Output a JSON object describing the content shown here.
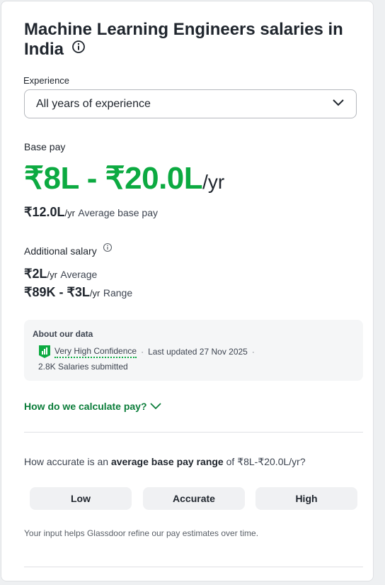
{
  "title": "Machine Learning Engineers salaries in India",
  "experience": {
    "label": "Experience",
    "selected": "All years of experience"
  },
  "base_pay": {
    "label": "Base pay",
    "range": "₹8L - ₹20.0L",
    "unit": "/yr",
    "average_value": "₹12.0L",
    "average_unit": "/yr",
    "average_label": "Average base pay"
  },
  "additional_salary": {
    "label": "Additional salary",
    "average_value": "₹2L",
    "average_unit": "/yr",
    "average_label": "Average",
    "range_value": "₹89K - ₹3L",
    "range_unit": "/yr",
    "range_label": "Range"
  },
  "about_data": {
    "title": "About our data",
    "confidence": "Very High Confidence",
    "separator": "·",
    "updated": "Last updated 27 Nov 2025",
    "submitted": "2.8K Salaries submitted"
  },
  "calc_link": "How do we calculate pay?",
  "feedback": {
    "question_prefix": "How accurate is an ",
    "question_bold": "average base pay range",
    "question_mid": " of ",
    "question_range": "₹8L-₹20.0L",
    "question_suffix": "/yr?",
    "buttons": [
      "Low",
      "Accurate",
      "High"
    ],
    "footnote": "Your input helps Glassdoor refine our pay estimates over time."
  },
  "icons": {
    "info": "info-icon",
    "dropdown": "chevron-down-icon",
    "confidence": "confidence-badge-icon",
    "calc": "chevron-down-icon"
  },
  "colors": {
    "accent_green": "#0caa41",
    "link_green": "#0b7d3a"
  }
}
